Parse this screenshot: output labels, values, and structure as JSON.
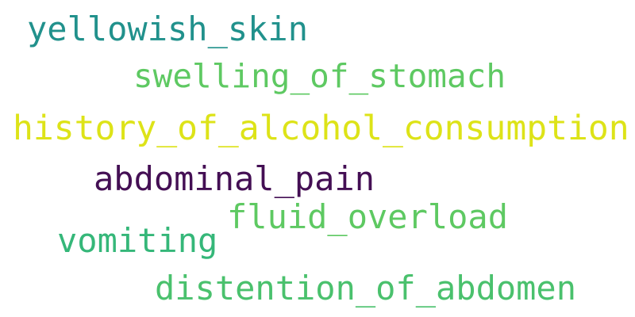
{
  "words": [
    {
      "text": "yellowish_skin",
      "color": "#21918c"
    },
    {
      "text": "swelling_of_stomach",
      "color": "#5ec962"
    },
    {
      "text": "history_of_alcohol_consumption",
      "color": "#dde318"
    },
    {
      "text": "abdominal_pain",
      "color": "#440f54"
    },
    {
      "text": "fluid_overload",
      "color": "#5ec962"
    },
    {
      "text": "vomiting",
      "color": "#35b779"
    },
    {
      "text": "distention_of_abdomen",
      "color": "#4ac16d"
    }
  ]
}
